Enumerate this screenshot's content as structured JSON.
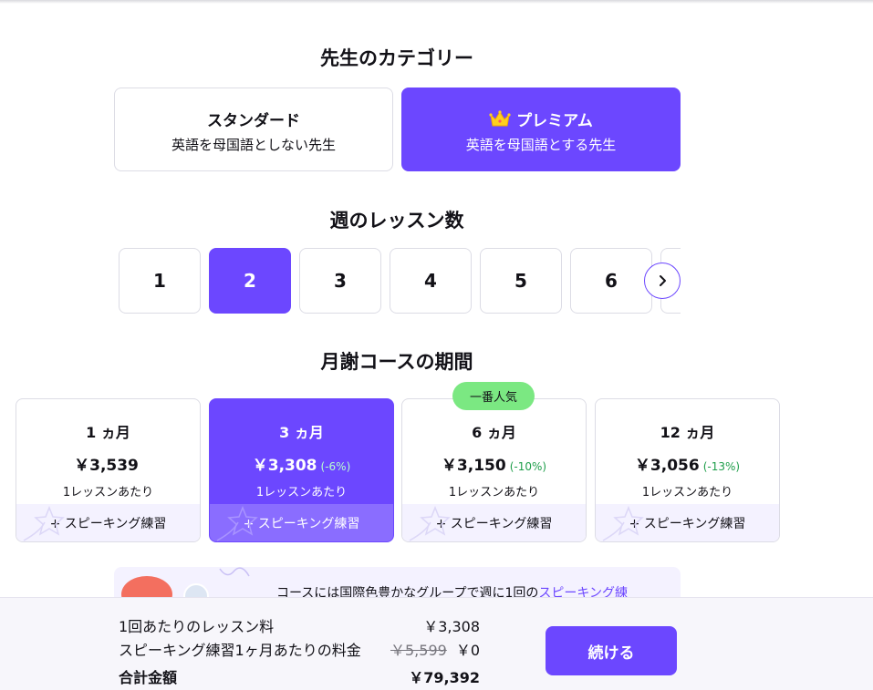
{
  "category": {
    "title": "先生のカテゴリー",
    "options": [
      {
        "name": "スタンダード",
        "sub": "英語を母国語としない先生",
        "selected": false
      },
      {
        "name": "プレミアム",
        "sub": "英語を母国語とする先生",
        "selected": true,
        "icon": "crown-icon"
      }
    ]
  },
  "lessons": {
    "title": "週のレッスン数",
    "options": [
      "1",
      "2",
      "3",
      "4",
      "5",
      "6"
    ],
    "selected": "2"
  },
  "duration": {
    "title": "月謝コースの期間",
    "popular_badge": "一番人気",
    "options": [
      {
        "label": "1 ヵ月",
        "price": "￥3,539",
        "discount": "",
        "per": "1レッスンあたり",
        "extra": "+ スピーキング練習",
        "selected": false
      },
      {
        "label": "3 ヵ月",
        "price": "￥3,308",
        "discount": "(-6%)",
        "per": "1レッスンあたり",
        "extra": "+ スピーキング練習",
        "selected": true
      },
      {
        "label": "6 ヵ月",
        "price": "￥3,150",
        "discount": "(-10%)",
        "per": "1レッスンあたり",
        "extra": "+ スピーキング練習",
        "selected": false
      },
      {
        "label": "12 ヵ月",
        "price": "￥3,056",
        "discount": "(-13%)",
        "per": "1レッスンあたり",
        "extra": "+ スピーキング練習",
        "selected": false
      }
    ]
  },
  "info": {
    "text": "コースには国際色豊かなグループで週に1回の",
    "link": "スピーキング練"
  },
  "summary": {
    "lesson_fee_label": "1回あたりのレッスン料",
    "lesson_fee_value": "￥3,308",
    "speaking_label": "スピーキング練習1ヶ月あたりの料金",
    "speaking_old": "￥5,599",
    "speaking_value": "￥0",
    "total_label": "合計金額",
    "total_value": "￥79,392",
    "continue": "続ける"
  },
  "colors": {
    "accent": "#6c47ff",
    "badge": "#7be882",
    "discount": "#1e9e4a"
  }
}
